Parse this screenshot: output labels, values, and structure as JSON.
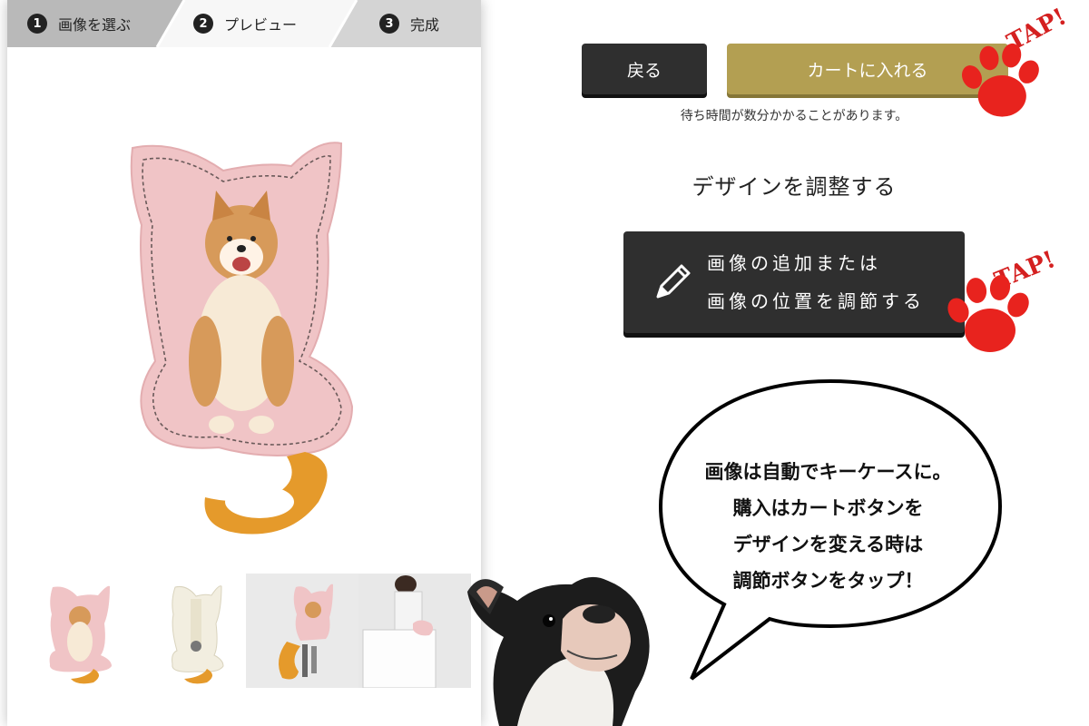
{
  "steps": [
    {
      "num": "1",
      "label": "画像を選ぶ"
    },
    {
      "num": "2",
      "label": "プレビュー"
    },
    {
      "num": "3",
      "label": "完成"
    }
  ],
  "buttons": {
    "back": "戻る",
    "cart": "カートに入れる",
    "adjust_line1": "画像の追加または",
    "adjust_line2": "画像の位置を調節する"
  },
  "wait_note": "待ち時間が数分かかることがあります。",
  "design_heading": "デザインを調整する",
  "tap_label": "TAP!",
  "bubble": {
    "line1": "画像は自動でキーケースに。",
    "line2": "購入はカートボタンを",
    "line3": "デザインを変える時は",
    "line4": "調節ボタンをタップ！"
  },
  "colors": {
    "accent_gold": "#b39f52",
    "dark_button": "#2f2f2f",
    "tap_red": "#d42020",
    "keycase_pink": "#f0c4c6",
    "strap_orange": "#e59a2b"
  },
  "icons": [
    "pencil-icon",
    "paw-icon",
    "speech-bubble"
  ]
}
